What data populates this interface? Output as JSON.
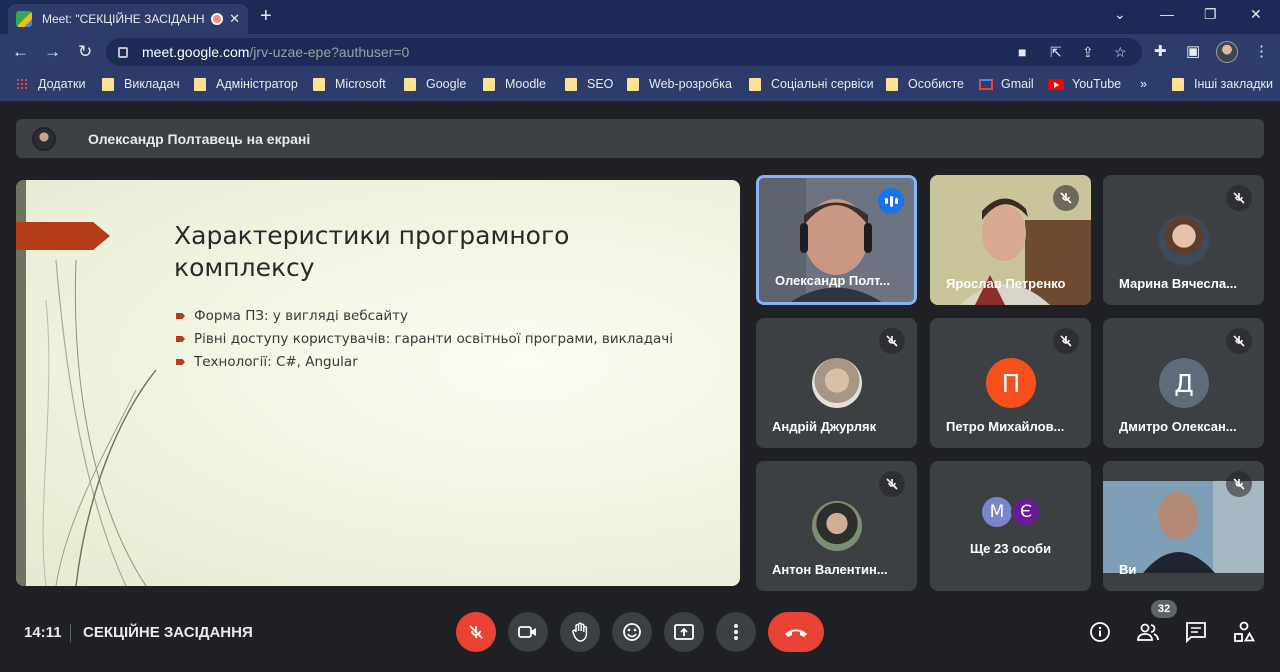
{
  "browser": {
    "tab_title": "Meet: \"СЕКЦІЙНЕ ЗАСІДАНН",
    "url_domain": "meet.google.com",
    "url_path": "/jrv-uzae-epe?authuser=0",
    "bookmarks": [
      "Додатки",
      "Викладач",
      "Адміністратор",
      "Microsoft",
      "Google",
      "Moodle",
      "SEO",
      "Web-розробка",
      "Соціальні сервіси",
      "Особисте",
      "Gmail",
      "YouTube",
      "Інші закладки"
    ]
  },
  "banner": {
    "presenter": "Олександр Полтавець на екрані"
  },
  "slide": {
    "title": "Характеристики програмного комплексу",
    "bullets": [
      "Форма ПЗ: у вигляді вебсайту",
      "Рівні доступу користувачів: гаранти освітньої програми, викладачі",
      "Технології: C#, Angular"
    ]
  },
  "participants": [
    {
      "name": "Олександр Полт...",
      "mic": "speaking"
    },
    {
      "name": "Ярослав Петренко",
      "mic": "muted"
    },
    {
      "name": "Марина Вячесла...",
      "mic": "muted"
    },
    {
      "name": "Андрій Джурляк",
      "mic": "muted"
    },
    {
      "name": "Петро Михайлов...",
      "mic": "muted",
      "initial": "П",
      "color": "#f4511e"
    },
    {
      "name": "Дмитро Олексан...",
      "mic": "muted",
      "initial": "Д",
      "color": "#5f6b7a"
    },
    {
      "name": "Антон Валентин...",
      "mic": "muted"
    },
    {
      "name": "Ще 23 особи",
      "initials": [
        "М",
        "Є"
      ]
    },
    {
      "name": "Ви",
      "mic": "muted"
    }
  ],
  "footer": {
    "time": "14:11",
    "meeting_name": "СЕКЦІЙНЕ ЗАСІДАННЯ",
    "participant_count": "32"
  },
  "colors": {
    "accent": "#1a73e8",
    "end_call": "#ea4335",
    "slide_arrow": "#b43d17"
  }
}
